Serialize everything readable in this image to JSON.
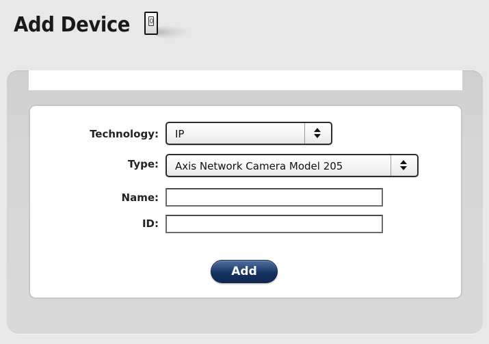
{
  "header": {
    "title": "Add Device",
    "icon": "mobile-device-icon"
  },
  "form": {
    "technology": {
      "label": "Technology:",
      "selected": "IP"
    },
    "type": {
      "label": "Type:",
      "selected": "Axis Network Camera Model 205"
    },
    "name": {
      "label": "Name:",
      "value": "",
      "placeholder": ""
    },
    "id": {
      "label": "ID:",
      "value": "",
      "placeholder": ""
    },
    "add_label": "Add"
  },
  "colors": {
    "page_background": "#e8e8e8",
    "panel_background": "#d6d6d6",
    "button_navy": "#163462"
  }
}
